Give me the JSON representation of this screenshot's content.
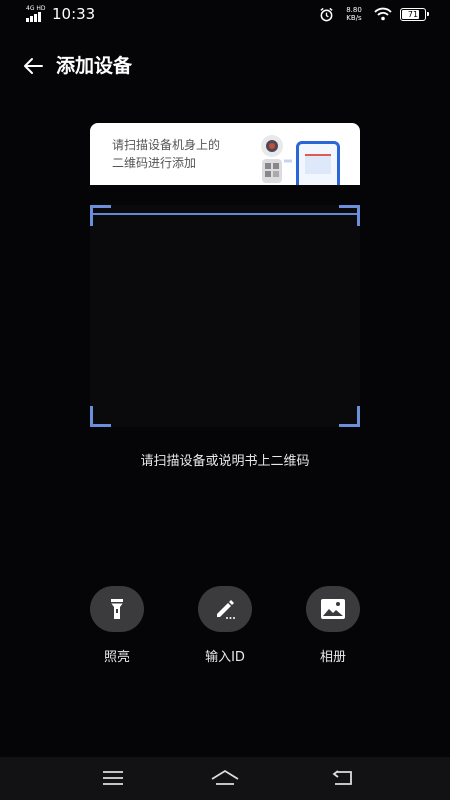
{
  "status": {
    "network_tag": "4G HD",
    "time": "10:33",
    "speed_value": "8.80",
    "speed_unit": "KB/s",
    "battery": "71",
    "battery_level": 0.71
  },
  "header": {
    "title": "添加设备"
  },
  "card": {
    "line1": "请扫描设备机身上的",
    "line2": "二维码进行添加"
  },
  "scan": {
    "hint": "请扫描设备或说明书上二维码"
  },
  "actions": [
    {
      "label": "照亮",
      "icon": "flashlight-icon"
    },
    {
      "label": "输入ID",
      "icon": "pencil-icon"
    },
    {
      "label": "相册",
      "icon": "image-icon"
    }
  ],
  "colors": {
    "accent": "#6c8fdc",
    "background": "#050507",
    "button": "#3b3b3e",
    "phone": "#2a66d8"
  }
}
